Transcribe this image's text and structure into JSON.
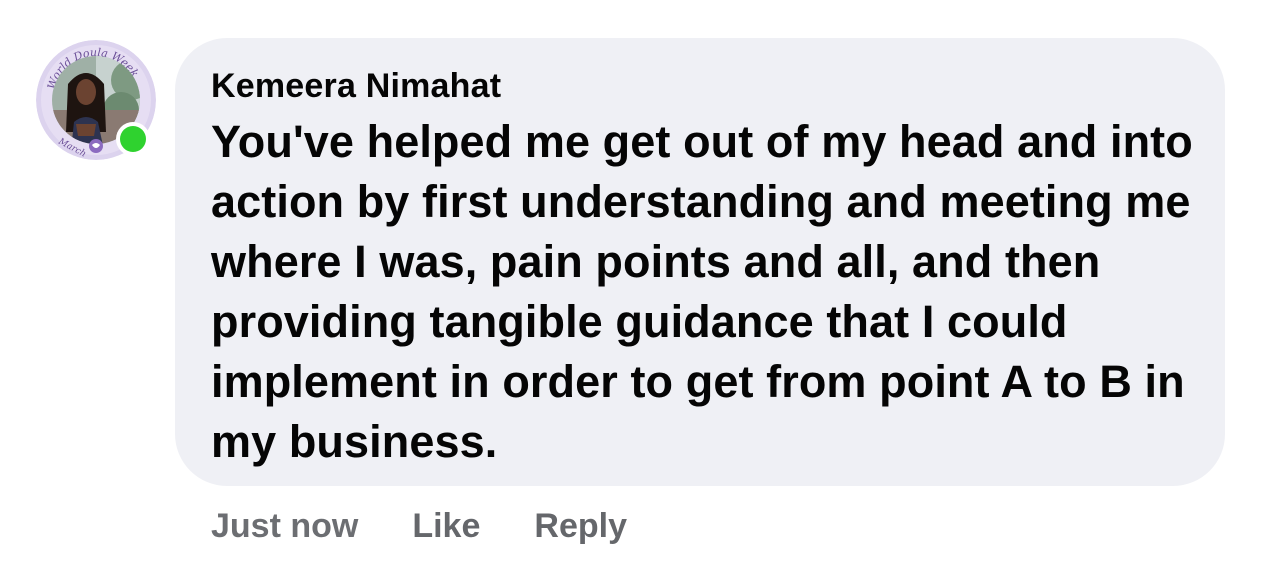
{
  "comment": {
    "author": "Kemeera Nimahat",
    "text": "You've helped me get out of my head and into action by first understanding and meeting me where I was, pain points and all, and then providing tangible guidance that I could implement in order to get from point A to B in my business.",
    "avatar": {
      "frame_text_top": "World Doula Week",
      "frame_text_bottom": "March",
      "online": true,
      "online_color": "#2fd22f"
    }
  },
  "actions": {
    "timestamp": "Just now",
    "like_label": "Like",
    "reply_label": "Reply"
  },
  "colors": {
    "bubble_background": "#eff0f5",
    "text_primary": "#050505",
    "text_secondary": "#65676b"
  }
}
